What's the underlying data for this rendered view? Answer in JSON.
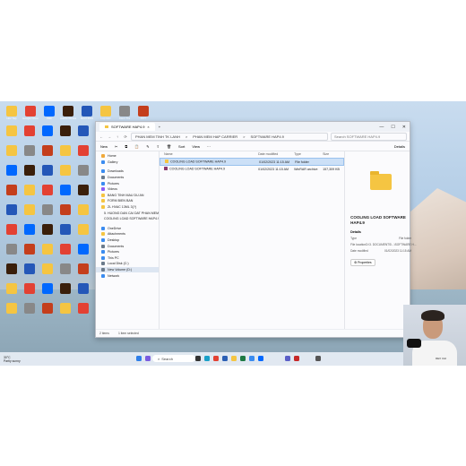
{
  "explorer": {
    "tab_title": "SOFTWARE HAP4.9",
    "close_glyph": "×",
    "new_tab_glyph": "+",
    "window_controls": [
      "—",
      "☐",
      "✕"
    ],
    "nav_glyphs": [
      "←",
      "→",
      "↑",
      "⟳"
    ],
    "breadcrumb": [
      "PHAN MEM TINH TK LANH",
      "PHAN MEM HAP CARRIER",
      "SOFTWARE HAP4.9"
    ],
    "breadcrumb_sep": ">",
    "search_placeholder": "Search SOFTWARE HAP4.9",
    "toolbar": {
      "new": "New",
      "sort": "Sort",
      "view": "View",
      "details": "Details",
      "more": "···"
    },
    "sidebar": [
      {
        "label": "Home",
        "color": "#f0a93b"
      },
      {
        "label": "Gallery",
        "color": "#3b8cf0"
      },
      {
        "gap": true
      },
      {
        "label": "Downloads",
        "color": "#3b8cf0"
      },
      {
        "label": "Documents",
        "color": "#6b7b8c"
      },
      {
        "label": "Pictures",
        "color": "#3b8cf0"
      },
      {
        "label": "Videos",
        "color": "#8b5cf6"
      },
      {
        "label": "BANG TINH MAU DU AN",
        "color": "#f5c542"
      },
      {
        "label": "FORM BIEN BAN",
        "color": "#f5c542"
      },
      {
        "label": "ZL HVAC 13ML 3(?)",
        "color": "#f5c542"
      },
      {
        "label": "5. HUONG DAN CAI DAT PHAN MEM H",
        "color": "#f5c542"
      },
      {
        "label": "COOLING LOAD SOFTWARE HAP4.9",
        "color": "#f5c542"
      },
      {
        "gap": true
      },
      {
        "label": "OneDrive",
        "color": "#3b8cf0"
      },
      {
        "label": "Attachments",
        "color": "#f5c542"
      },
      {
        "label": "Desktop",
        "color": "#3b8cf0"
      },
      {
        "label": "Documents",
        "color": "#6b7b8c"
      },
      {
        "label": "Pictures",
        "color": "#3b8cf0"
      },
      {
        "label": "This PC",
        "color": "#3b8cf0"
      },
      {
        "label": "Local Disk (C:)",
        "color": "#6b7b8c"
      },
      {
        "label": "New Volume (D:)",
        "color": "#6b7b8c",
        "selected": true
      },
      {
        "label": "Network",
        "color": "#3b8cf0"
      }
    ],
    "columns": {
      "name": "Name",
      "date": "Date modified",
      "type": "Type",
      "size": "Size"
    },
    "files": [
      {
        "name": "COOLING LOAD SOFTWARE HAP4.9",
        "date": "01/02/2023 11:15 AM",
        "type": "File folder",
        "size": "",
        "color": "#f5c542",
        "selected": true
      },
      {
        "name": "COOLING LOAD SOFTWARE HAP4.9",
        "date": "01/02/2023 11:15 AM",
        "type": "WinRAR archive",
        "size": "157,309 KB",
        "color": "#8b3b6f",
        "selected": false
      }
    ],
    "preview": {
      "title": "COOLING LOAD SOFTWARE HAP4.9",
      "details_label": "Details",
      "rows": [
        {
          "k": "Type",
          "v": "File folder"
        },
        {
          "k": "File location",
          "v": "D:\\3. DOCUMENTS\\...\\SOFTWARE H..."
        },
        {
          "k": "Date modified",
          "v": "01/02/2023 11:15 AM"
        }
      ],
      "properties": "Properties"
    },
    "status": {
      "items": "2 items",
      "selected": "1 item selected"
    }
  },
  "taskbar": {
    "weather_temp": "30°C",
    "weather_desc": "Partly sunny",
    "search": "Search",
    "icons": [
      {
        "name": "start",
        "color": "#2f7fe8"
      },
      {
        "name": "copilot",
        "color": "#7a5ce0"
      },
      {
        "name": "widgets",
        "color": "#333333"
      },
      {
        "name": "edge",
        "color": "#1aa0c8"
      },
      {
        "name": "chrome",
        "color": "#e34133"
      },
      {
        "name": "word",
        "color": "#2b5fb4"
      },
      {
        "name": "explorer",
        "color": "#f5c542"
      },
      {
        "name": "excel",
        "color": "#1e7a44"
      },
      {
        "name": "store",
        "color": "#3b8cf0"
      },
      {
        "name": "zalo",
        "color": "#0068ff"
      },
      {
        "name": "teams",
        "color": "#5b5fc7"
      },
      {
        "name": "autocad",
        "color": "#c62828"
      },
      {
        "name": "notes",
        "color": "#555555"
      }
    ]
  },
  "desktop": {
    "icons": [
      {
        "label": "Hoc Tap",
        "color": "#f5c542"
      },
      {
        "label": "Google Chrome",
        "color": "#e34133"
      },
      {
        "label": "Zalo",
        "color": "#0068ff"
      },
      {
        "label": "Adobe Illustrator",
        "color": "#3a1f0a"
      },
      {
        "label": "Revit 2021",
        "color": "#2457b8"
      },
      {
        "label": "Lop Hoc",
        "color": "#f5c542"
      },
      {
        "label": "Kiem Tra",
        "color": "#888888"
      },
      {
        "label": "PPT",
        "color": "#c43e1c"
      }
    ]
  },
  "webcam": {
    "tag": "REX CHI"
  }
}
